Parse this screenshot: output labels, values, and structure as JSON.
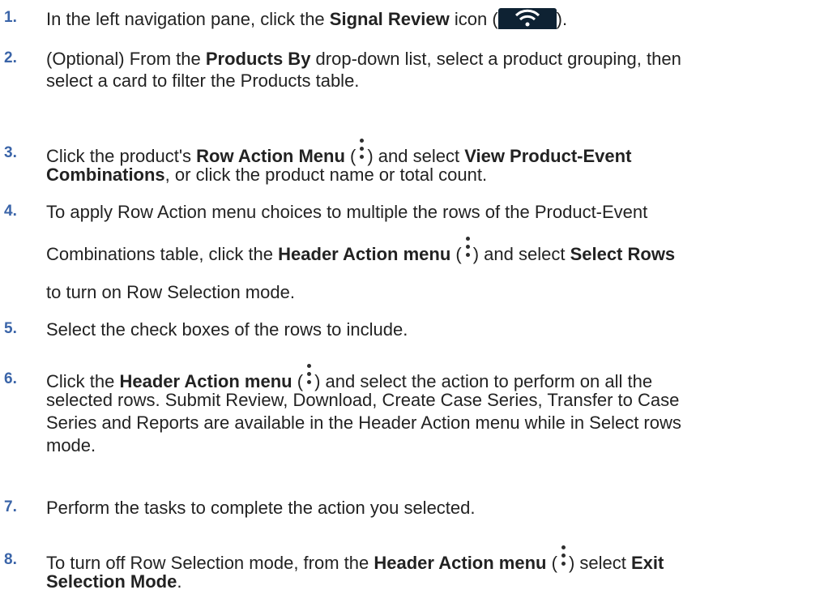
{
  "steps": [
    {
      "num": "1.",
      "lines": [
        {
          "t1": "In the left navigation pane, click the ",
          "b1": "Signal Review",
          "t2": " icon (",
          "t3": ")."
        }
      ]
    },
    {
      "num": "2.",
      "lines": [
        {
          "t1": "(Optional) From the ",
          "b1": "Products By",
          "t2": " drop-down list, select a product grouping, then"
        },
        {
          "t1": "select a card to filter the Products table."
        }
      ]
    },
    {
      "num": "3.",
      "lines": [
        {
          "t1": "Click the product's ",
          "b1": "Row Action Menu",
          "t2": " (",
          "t3": ") and select ",
          "b2": "View Product-Event"
        },
        {
          "b1": "Combinations",
          "t1": ", or click the product name or total count."
        }
      ]
    },
    {
      "num": "4.",
      "lines": [
        {
          "t1": "To apply Row Action menu choices to multiple the rows of the Product-Event"
        },
        {
          "t1": "Combinations table, click the ",
          "b1": "Header Action menu",
          "t2": " (",
          "t3": ") and select ",
          "b2": "Select Rows"
        },
        {
          "t1": "to turn on Row Selection mode."
        }
      ]
    },
    {
      "num": "5.",
      "lines": [
        {
          "t1": "Select the check boxes of the rows to include."
        }
      ]
    },
    {
      "num": "6.",
      "lines": [
        {
          "t1": "Click the ",
          "b1": "Header Action menu",
          "t2": " (",
          "t3": ") and select the action to perform on all the"
        },
        {
          "t1": "selected rows. Submit Review, Download, Create Case Series, Transfer to Case"
        },
        {
          "t1": "Series and Reports are available in the Header Action menu while in Select rows"
        },
        {
          "t1": "mode."
        }
      ]
    },
    {
      "num": "7.",
      "lines": [
        {
          "t1": "Perform the tasks to complete the action you selected."
        }
      ]
    },
    {
      "num": "8.",
      "lines": [
        {
          "t1": "To turn off Row Selection mode, from the ",
          "b1": "Header Action menu",
          "t2": " (",
          "t3": ") select ",
          "b2": "Exit"
        },
        {
          "b1": "Selection Mode",
          "t1": "."
        }
      ]
    }
  ]
}
